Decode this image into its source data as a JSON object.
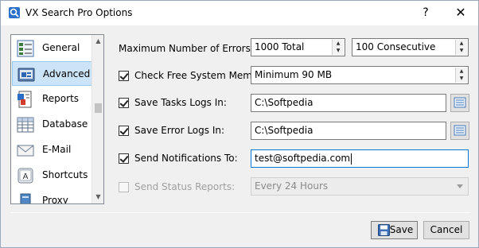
{
  "window": {
    "title": "VX Search Pro Options",
    "help_label": "?",
    "close_label": "✕"
  },
  "sidebar": {
    "items": [
      {
        "label": "General",
        "icon": "general-icon"
      },
      {
        "label": "Advanced",
        "icon": "advanced-icon",
        "selected": true
      },
      {
        "label": "Reports",
        "icon": "reports-icon"
      },
      {
        "label": "Database",
        "icon": "database-icon"
      },
      {
        "label": "E-Mail",
        "icon": "email-icon"
      },
      {
        "label": "Shortcuts",
        "icon": "shortcuts-icon"
      },
      {
        "label": "Proxy",
        "icon": "proxy-icon"
      }
    ],
    "scroll_up": "▲",
    "scroll_down": "▼"
  },
  "options": {
    "max_errors": {
      "label": "Maximum Number of Errors:",
      "total_value": "1000 Total",
      "consecutive_value": "100 Consecutive"
    },
    "free_memory": {
      "label": "Check Free System Memory:",
      "checked": true,
      "value": "Minimum 90 MB"
    },
    "task_logs": {
      "label": "Save Tasks Logs In:",
      "checked": true,
      "value": "C:\\Softpedia"
    },
    "error_logs": {
      "label": "Save Error Logs In:",
      "checked": true,
      "value": "C:\\Softpedia"
    },
    "notifications": {
      "label": "Send Notifications To:",
      "checked": true,
      "value": "test@softpedia.com"
    },
    "status_reports": {
      "label": "Send Status Reports:",
      "checked": false,
      "enabled": false,
      "value": "Every 24 Hours"
    }
  },
  "footer": {
    "save_label": "Save",
    "cancel_label": "Cancel"
  },
  "colors": {
    "selection": "#cce4f7",
    "focus_border": "#0078d7",
    "window_bg": "#f0f0f0"
  }
}
